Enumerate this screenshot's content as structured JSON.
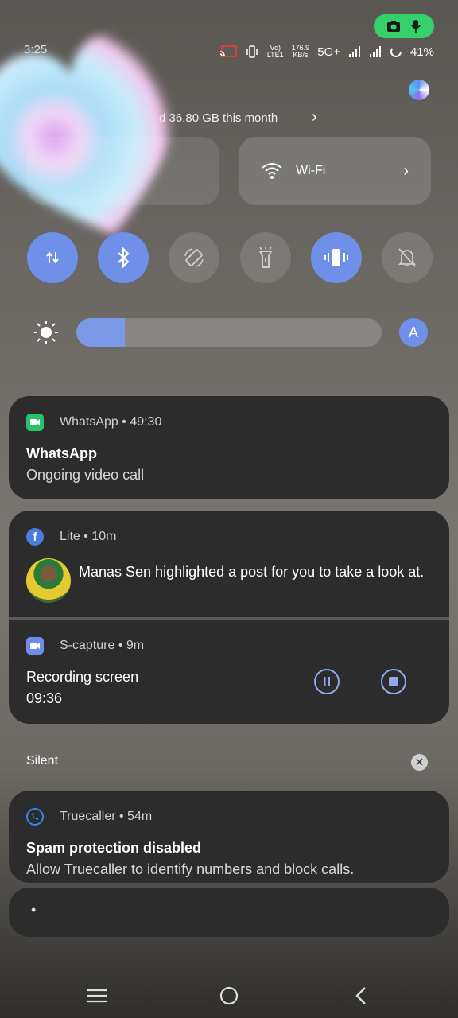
{
  "status": {
    "time": "3:25",
    "net_speed_top": "176.9",
    "net_speed_unit": "KB/s",
    "volte": "Vo)",
    "lte": "LTE1",
    "network": "5G+",
    "battery": "41%"
  },
  "data_usage": {
    "text": "d 36.80 GB this month"
  },
  "tiles": {
    "wifi_label": "Wi-Fi"
  },
  "quick_settings": [
    {
      "name": "mobile-data",
      "on": true
    },
    {
      "name": "bluetooth",
      "on": true
    },
    {
      "name": "auto-rotate",
      "on": false
    },
    {
      "name": "flashlight",
      "on": false
    },
    {
      "name": "vibrate",
      "on": true
    },
    {
      "name": "dnd",
      "on": false
    }
  ],
  "brightness": {
    "level": 0.16,
    "auto_label": "A"
  },
  "notifications": {
    "whatsapp": {
      "app": "WhatsApp",
      "time": "49:30",
      "title": "WhatsApp",
      "body": "Ongoing video call"
    },
    "lite": {
      "app": "Lite",
      "time": "10m",
      "body": "Manas Sen highlighted a post for you to take a look at."
    },
    "scapture": {
      "app": "S-capture",
      "time": "9m",
      "title": "Recording screen",
      "elapsed": "09:36"
    },
    "silent_header": "Silent",
    "truecaller": {
      "app": "Truecaller",
      "time": "54m",
      "title": "Spam protection disabled",
      "body": "Allow Truecaller to identify numbers and block calls."
    },
    "collapsed_dot": "•"
  },
  "colors": {
    "accent": "#6f90e8",
    "card": "#2c2c2c",
    "whatsapp": "#25c267",
    "facebook": "#4a7ce0",
    "scapture": "#6f8ee8",
    "truecaller": "#2a8cf0",
    "rec_pill": "#35d06a"
  }
}
